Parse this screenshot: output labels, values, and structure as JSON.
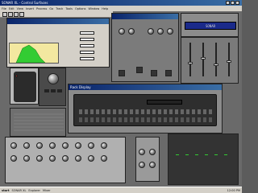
{
  "app": {
    "title": "SONAR XL - Control Surfaces"
  },
  "menu": {
    "items": [
      "File",
      "Edit",
      "View",
      "Insert",
      "Process",
      "Go",
      "Track",
      "Tools",
      "Options",
      "Window",
      "Help"
    ]
  },
  "control_surface": {
    "display_text": "SONAR",
    "device_name": "Mackie Control"
  },
  "rack": {
    "title": "Rack Display",
    "screen_text": "C:\\Program Files\\Cakewalk Projects\\Demo"
  },
  "status_bar": {
    "text": "For Help, press F1"
  },
  "taskbar": {
    "start_label": "start",
    "clock": "12:00 PM",
    "items": [
      "SONAR XL",
      "Explorer",
      "Mixer"
    ]
  },
  "colors": {
    "accent": "#0a246a",
    "desktop": "#5c5c5c",
    "eq_green": "#33cc33",
    "eq_yellow": "#f0d23c"
  }
}
